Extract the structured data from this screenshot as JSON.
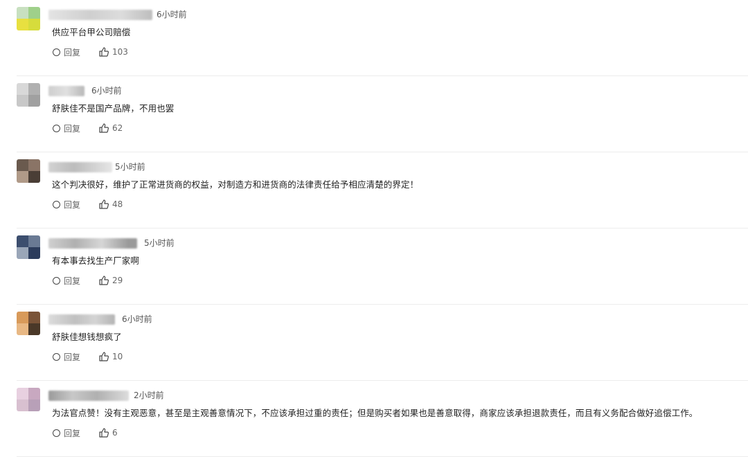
{
  "reply_label": "回复",
  "comments": [
    {
      "time": "6小时前",
      "text": "供应平台甲公司赔偿",
      "likes": "103",
      "avatar_colors": [
        "#c8e0c0",
        "#9fd08a",
        "#e8e040",
        "#d6dc3c"
      ]
    },
    {
      "time": "6小时前",
      "text": "舒肤佳不是国产品牌，不用也罢",
      "likes": "62",
      "avatar_colors": [
        "#d8d8d8",
        "#b0b0b0",
        "#c8c8c8",
        "#a0a0a0"
      ]
    },
    {
      "time": "5小时前",
      "text": "这个判决很好，维护了正常进货商的权益，对制造方和进货商的法律责任给予相应清楚的界定！",
      "likes": "48",
      "avatar_colors": [
        "#6a5a4e",
        "#8a7466",
        "#b09a88",
        "#4a3e36"
      ]
    },
    {
      "time": "5小时前",
      "text": "有本事去找生产厂家啊",
      "likes": "29",
      "avatar_colors": [
        "#3c4e6e",
        "#6a7a94",
        "#9aa6b8",
        "#2c3c5c"
      ]
    },
    {
      "time": "6小时前",
      "text": "舒肤佳想钱想疯了",
      "likes": "10",
      "avatar_colors": [
        "#d89a5a",
        "#7a5438",
        "#e8b884",
        "#4a3828"
      ]
    },
    {
      "time": "2小时前",
      "text": "为法官点赞！没有主观恶意，甚至是主观善意情况下，不应该承担过重的责任；但是购买者如果也是善意取得，商家应该承担退款责任，而且有义务配合做好追偿工作。",
      "likes": "6",
      "avatar_colors": [
        "#e8d0e0",
        "#c8a8c0",
        "#d8c0d0",
        "#b8a0b8"
      ]
    }
  ]
}
